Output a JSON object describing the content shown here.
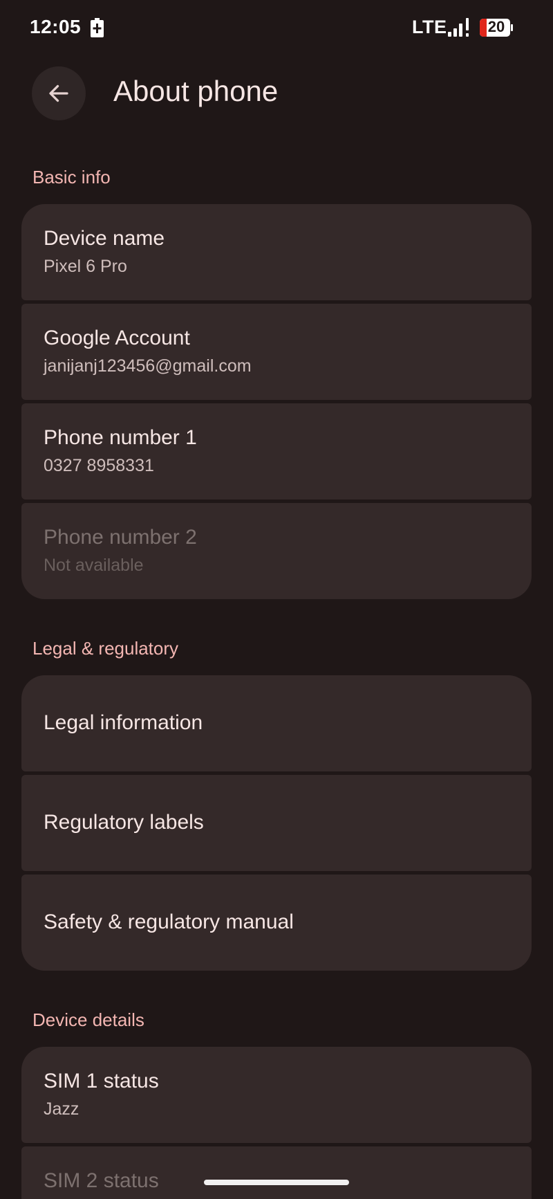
{
  "status_bar": {
    "time": "12:05",
    "network": "LTE",
    "battery_level": "20",
    "icons": [
      "charging-icon",
      "signal-icon",
      "battery-icon"
    ]
  },
  "header": {
    "back_icon": "arrow-back-icon",
    "title": "About phone"
  },
  "sections": {
    "basic_info": {
      "label": "Basic info",
      "items": [
        {
          "title": "Device name",
          "subtitle": "Pixel 6 Pro"
        },
        {
          "title": "Google Account",
          "subtitle": "janijanj123456@gmail.com"
        },
        {
          "title": "Phone number 1",
          "subtitle": "0327 8958331"
        },
        {
          "title": "Phone number 2",
          "subtitle": "Not available"
        }
      ]
    },
    "legal": {
      "label": "Legal & regulatory",
      "items": [
        {
          "title": "Legal information"
        },
        {
          "title": "Regulatory labels"
        },
        {
          "title": "Safety & regulatory manual"
        }
      ]
    },
    "device_details": {
      "label": "Device details",
      "items": [
        {
          "title": "SIM 1 status",
          "subtitle": "Jazz"
        },
        {
          "title": "SIM 2 status"
        }
      ]
    }
  },
  "colors": {
    "background": "#1f1717",
    "card": "#342929",
    "accent": "#f3b6b2",
    "battery_low": "#e0261b"
  }
}
